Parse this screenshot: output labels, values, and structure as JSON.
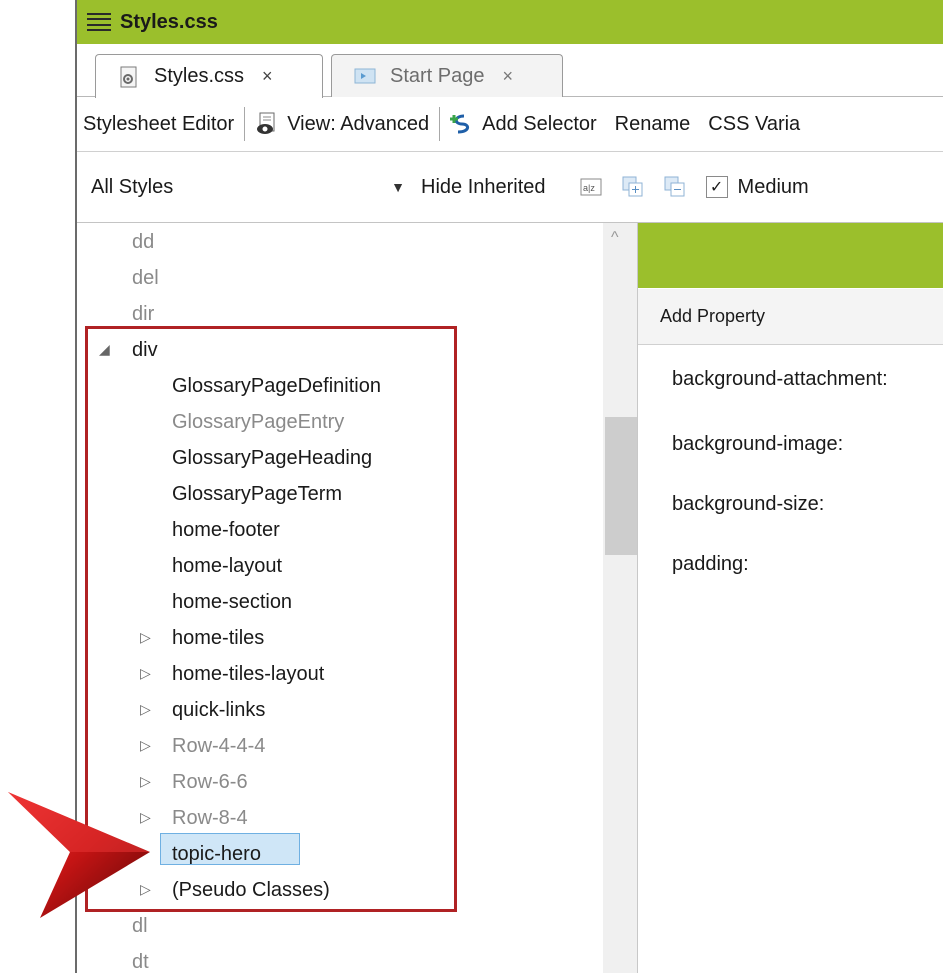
{
  "window": {
    "title": "Styles.css"
  },
  "tabs": [
    {
      "label": "Styles.css",
      "close": "×",
      "active": true
    },
    {
      "label": "Start Page",
      "close": "×",
      "active": false
    }
  ],
  "toolbar": {
    "stylesheet_editor": "Stylesheet Editor",
    "view": "View: Advanced",
    "add_selector": "Add Selector",
    "rename": "Rename",
    "css_variables": "CSS Varia"
  },
  "filterbar": {
    "selected_filter": "All Styles",
    "hide_inherited": "Hide Inherited",
    "medium_label": "Medium",
    "medium_checked": true
  },
  "tree": {
    "items": [
      {
        "label": "dd",
        "indent": 0,
        "expander": "",
        "grey": true
      },
      {
        "label": "del",
        "indent": 0,
        "expander": "",
        "grey": true
      },
      {
        "label": "dir",
        "indent": 0,
        "expander": "",
        "grey": true
      },
      {
        "label": "div",
        "indent": 0,
        "expander": "◢",
        "grey": false
      },
      {
        "label": "GlossaryPageDefinition",
        "indent": 1,
        "expander": "",
        "grey": false
      },
      {
        "label": "GlossaryPageEntry",
        "indent": 1,
        "expander": "",
        "grey": true
      },
      {
        "label": "GlossaryPageHeading",
        "indent": 1,
        "expander": "",
        "grey": false
      },
      {
        "label": "GlossaryPageTerm",
        "indent": 1,
        "expander": "",
        "grey": false
      },
      {
        "label": "home-footer",
        "indent": 1,
        "expander": "",
        "grey": false
      },
      {
        "label": "home-layout",
        "indent": 1,
        "expander": "",
        "grey": false
      },
      {
        "label": "home-section",
        "indent": 1,
        "expander": "",
        "grey": false
      },
      {
        "label": "home-tiles",
        "indent": 1,
        "expander": "▷",
        "grey": false
      },
      {
        "label": "home-tiles-layout",
        "indent": 1,
        "expander": "▷",
        "grey": false
      },
      {
        "label": "quick-links",
        "indent": 1,
        "expander": "▷",
        "grey": false
      },
      {
        "label": "Row-4-4-4",
        "indent": 1,
        "expander": "▷",
        "grey": true
      },
      {
        "label": "Row-6-6",
        "indent": 1,
        "expander": "▷",
        "grey": true
      },
      {
        "label": "Row-8-4",
        "indent": 1,
        "expander": "▷",
        "grey": true
      },
      {
        "label": "topic-hero",
        "indent": 1,
        "expander": "",
        "grey": false,
        "selected": true
      },
      {
        "label": "(Pseudo Classes)",
        "indent": 1,
        "expander": "▷",
        "grey": false
      },
      {
        "label": "dl",
        "indent": 0,
        "expander": "",
        "grey": true
      },
      {
        "label": "dt",
        "indent": 0,
        "expander": "",
        "grey": true
      }
    ]
  },
  "properties": {
    "add_property": "Add Property",
    "items": [
      "background-attachment:",
      "background-image:",
      "background-size:",
      "padding:"
    ]
  },
  "colors": {
    "accent_green": "#9bbf2c",
    "highlight_red": "#b02224",
    "selection_blue": "#cfe6f7"
  }
}
